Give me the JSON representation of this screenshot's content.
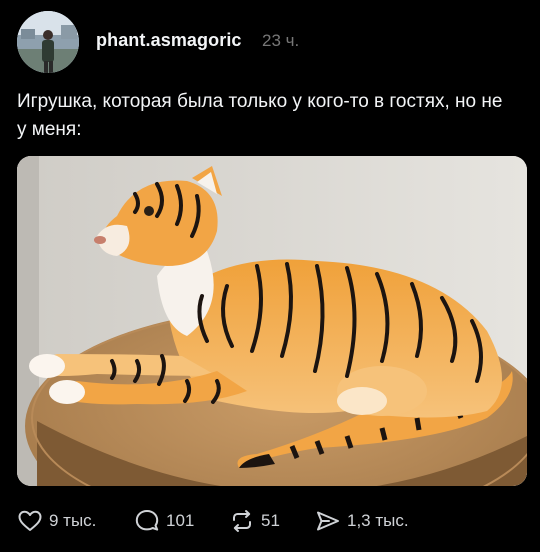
{
  "post": {
    "author": "phant.asmagoric",
    "time": "23 ч.",
    "text": "Игрушка, которая была только у кого-то в гостях, но не у меня:",
    "media_icon": "photo-plush-tiger"
  },
  "actions": {
    "likes": "9 тыс.",
    "replies": "101",
    "reposts": "51",
    "shares": "1,3 тыс."
  },
  "icons": {
    "like": "heart-icon",
    "reply": "speech-bubble-icon",
    "repost": "repost-arrows-icon",
    "share": "paper-plane-icon"
  },
  "colors": {
    "background": "#000000",
    "text": "#f3f5f7",
    "muted": "#777777",
    "icon": "#cfd2d6"
  }
}
